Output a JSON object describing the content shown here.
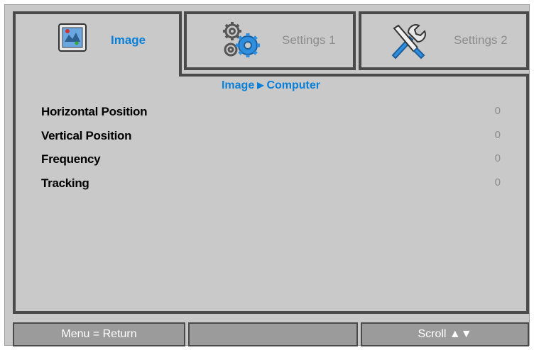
{
  "tabs": [
    {
      "label": "Image",
      "icon": "image-adjust-icon",
      "active": true
    },
    {
      "label": "Settings 1",
      "icon": "gears-icon",
      "active": false
    },
    {
      "label": "Settings 2",
      "icon": "tools-icon",
      "active": false
    }
  ],
  "breadcrumb": {
    "parent": "Image",
    "separator": "▶",
    "current": "Computer"
  },
  "items": [
    {
      "label": "Horizontal Position",
      "value": "0"
    },
    {
      "label": "Vertical Position",
      "value": "0"
    },
    {
      "label": "Frequency",
      "value": "0"
    },
    {
      "label": "Tracking",
      "value": "0"
    }
  ],
  "footer": {
    "left": "Menu = Return",
    "middle": "",
    "right": "Scroll ▲▼"
  },
  "colors": {
    "accent": "#0a7fd8",
    "background": "#c9c9c9",
    "border": "#4a4a4a",
    "footer": "#9b9b9b",
    "value": "#8c8c8c"
  }
}
